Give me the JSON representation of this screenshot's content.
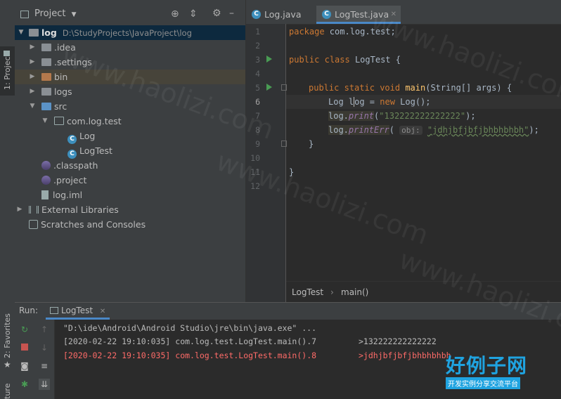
{
  "side_tabs": {
    "project": "1: Project",
    "favorites": "2: Favorites",
    "structure": "ture"
  },
  "project_panel": {
    "title": "Project",
    "tree": [
      {
        "label": "log",
        "path": "D:\\StudyProjects\\JavaProject\\log"
      },
      {
        "label": ".idea"
      },
      {
        "label": ".settings"
      },
      {
        "label": "bin"
      },
      {
        "label": "logs"
      },
      {
        "label": "src"
      },
      {
        "label": "com.log.test"
      },
      {
        "label": "Log"
      },
      {
        "label": "LogTest"
      },
      {
        "label": ".classpath"
      },
      {
        "label": ".project"
      },
      {
        "label": "log.iml"
      },
      {
        "label": "External Libraries"
      },
      {
        "label": "Scratches and Consoles"
      }
    ]
  },
  "editor": {
    "tabs": [
      {
        "label": "Log.java"
      },
      {
        "label": "LogTest.java"
      }
    ],
    "line_numbers": [
      "1",
      "2",
      "3",
      "4",
      "5",
      "6",
      "7",
      "8",
      "9",
      "10",
      "11",
      "12"
    ],
    "code": {
      "l1_kw": "package",
      "l1_rest": " com.log.test;",
      "l3_kw1": "public",
      "l3_kw2": "class",
      "l3_rest": " LogTest {",
      "l5_kw1": "public",
      "l5_kw2": "static",
      "l5_kw3": "void",
      "l5_fn": "main",
      "l5_rest": "(String[] args) {",
      "l6_a": "Log l",
      "l6_b": "og = ",
      "l6_kw": "new",
      "l6_rest": " Log();",
      "l7_a": "log.",
      "l7_m": "print",
      "l7_b": "(",
      "l7_s": "\"132222222222222\"",
      "l7_c": ");",
      "l8_a": "log.",
      "l8_m": "printErr",
      "l8_b": "( ",
      "l8_hint": "obj:",
      "l8_s": "\"jdhjbfjbfjbhbhbhbh\"",
      "l8_c": ");",
      "l9": "}",
      "l11": "}"
    },
    "breadcrumb": [
      "LogTest",
      "main()"
    ]
  },
  "run_panel": {
    "label": "Run:",
    "tab": "LogTest",
    "console": [
      {
        "text": "\"D:\\ide\\Android\\Android Studio\\jre\\bin\\java.exe\" ...",
        "color": "#a0a0a0"
      },
      {
        "ts": "[2020-02-22 19:10:035]",
        "src": "com.log.test.LogTest.main().7",
        "msg": ">132222222222222",
        "color": "#bbbbbb"
      },
      {
        "ts": "[2020-02-22 19:10:035]",
        "src": "com.log.test.LogTest.main().8",
        "msg": ">jdhjbfjbfjbhbhbhbh",
        "color": "#ff6b68"
      }
    ]
  },
  "watermark": {
    "site": "www.haolizi.com",
    "logo_big": "好例子网",
    "logo_small": "开发实例分享交流平台"
  },
  "colors": {
    "keyword": "#cc7832",
    "string": "#6a8759",
    "method": "#ffc66d",
    "error": "#ff6b68",
    "selected_row": "#0d293e"
  }
}
